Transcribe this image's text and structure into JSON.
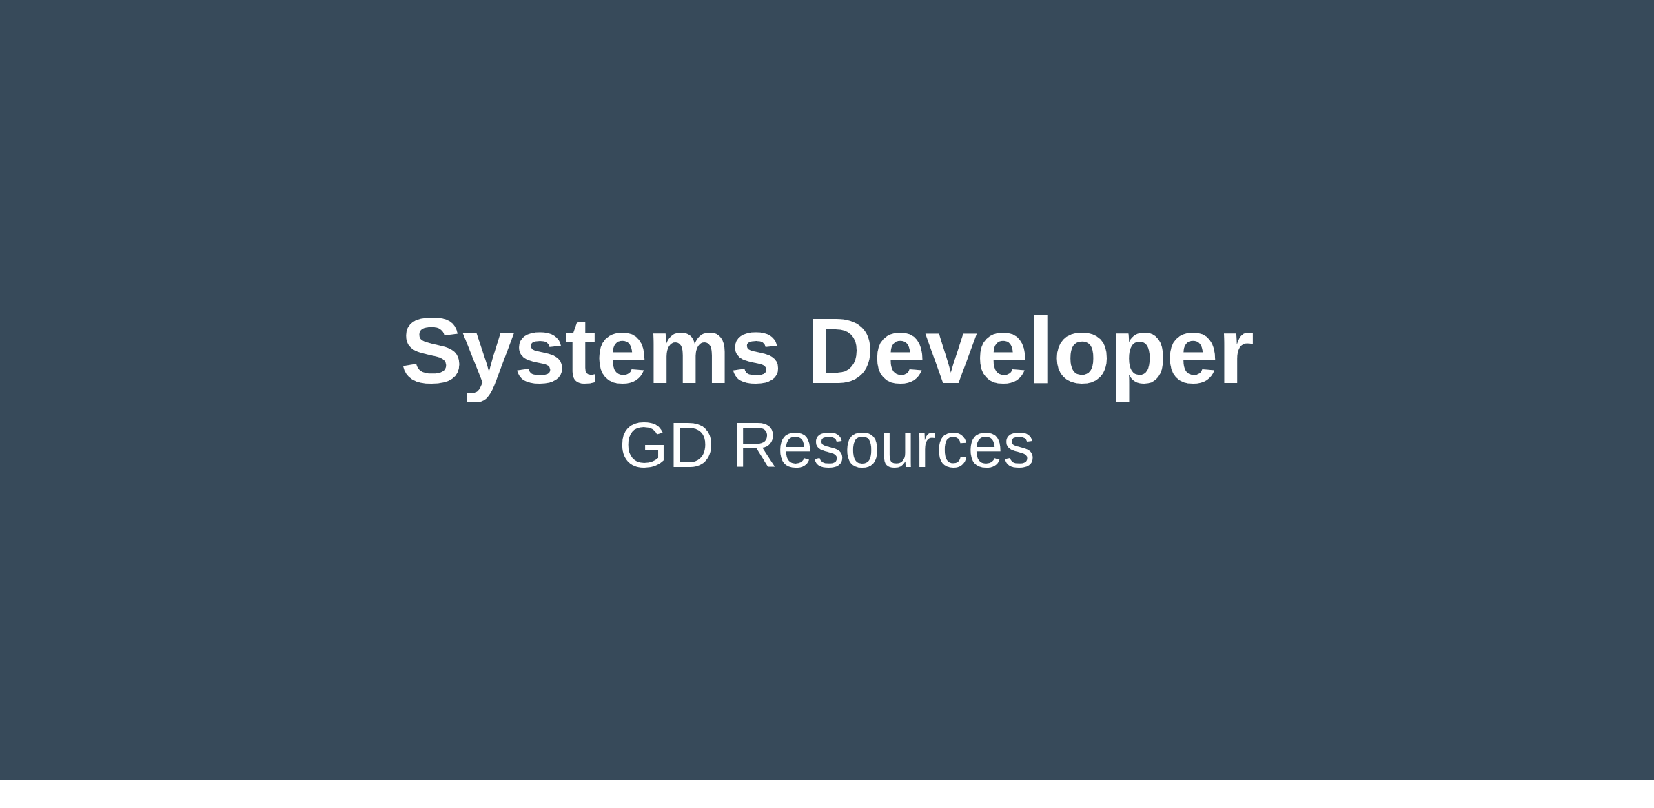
{
  "hero": {
    "title": "Systems Developer",
    "subtitle": "GD Resources"
  }
}
